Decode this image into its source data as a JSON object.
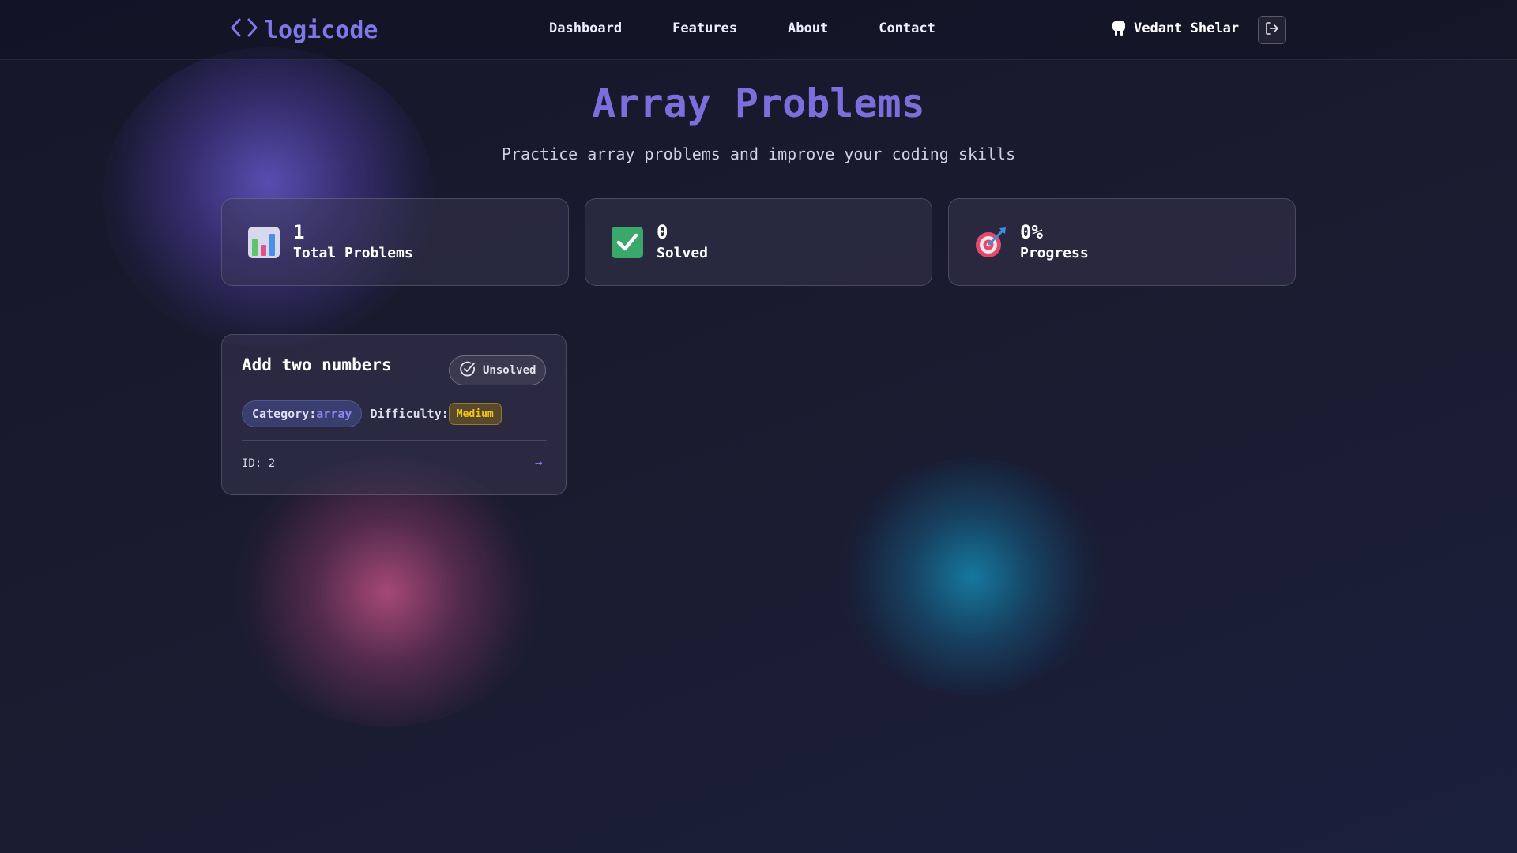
{
  "brand": {
    "logo_text": "logicode",
    "logo_icon": "code-brackets-icon"
  },
  "nav": {
    "items": [
      {
        "label": "Dashboard"
      },
      {
        "label": "Features"
      },
      {
        "label": "About"
      },
      {
        "label": "Contact"
      }
    ]
  },
  "user": {
    "name": "Vedant Shelar",
    "icon": "user-icon",
    "logout_icon": "logout-icon"
  },
  "page": {
    "title": "Array Problems",
    "subtitle": "Practice array problems and improve your coding skills"
  },
  "stats": [
    {
      "value": "1",
      "label": "Total Problems",
      "icon": "bar-chart-icon"
    },
    {
      "value": "0",
      "label": "Solved",
      "icon": "check-box-icon"
    },
    {
      "value": "0%",
      "label": "Progress",
      "icon": "target-icon"
    }
  ],
  "problems": [
    {
      "title": "Add two numbers",
      "status": "Unsolved",
      "category_label": "Category:",
      "category_value": "array",
      "difficulty_label": "Difficulty:",
      "difficulty_value": "Medium",
      "id_text": "ID: 2",
      "arrow": "→"
    }
  ],
  "colors": {
    "accent": "#7b6fdc",
    "difficulty_medium": "#f5c518",
    "background": "#1a1b2e"
  }
}
